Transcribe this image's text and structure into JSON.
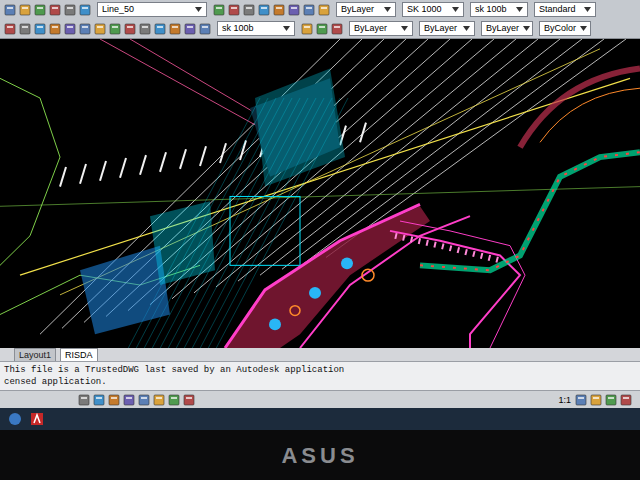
{
  "toolbar": {
    "row1_combos": [
      {
        "label": "Line_50"
      },
      {
        "label": "ByLayer"
      },
      {
        "label": "SK 1000"
      },
      {
        "label": "sk 100b"
      },
      {
        "label": "Standard"
      }
    ],
    "row2_combos": [
      {
        "label": "sk 100b"
      },
      {
        "label": "ByLayer"
      },
      {
        "label": "ByLayer"
      },
      {
        "label": "ByLayer"
      },
      {
        "label": "ByColor"
      }
    ]
  },
  "layout_tabs": [
    {
      "label": "Layout1",
      "selected": false
    },
    {
      "label": "RISDA",
      "selected": true
    }
  ],
  "command_lines": [
    "This file is a TrustedDWG last saved by an Autodesk application",
    "censed application."
  ],
  "status_bar": {
    "scale": "1:1"
  },
  "monitor": {
    "brand": "ASUS"
  }
}
